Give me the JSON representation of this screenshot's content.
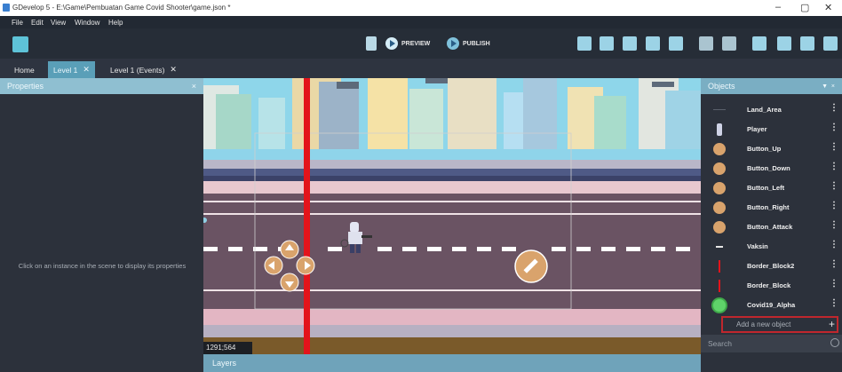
{
  "window": {
    "title": "GDevelop 5 - E:\\Game\\Pembuatan Game Covid Shooter\\game.json *",
    "controls": [
      "–",
      "▢",
      "✕"
    ]
  },
  "menu": [
    "File",
    "Edit",
    "View",
    "Window",
    "Help"
  ],
  "toolbar": {
    "preview_label": "PREVIEW",
    "publish_label": "PUBLISH"
  },
  "tabs": [
    {
      "label": "Home",
      "closable": false,
      "active": false
    },
    {
      "label": "Level 1",
      "closable": true,
      "active": true
    },
    {
      "label": "Level 1 (Events)",
      "closable": true,
      "active": false
    }
  ],
  "properties": {
    "title": "Properties",
    "close": "×",
    "hint": "Click on an instance in the scene to display its properties"
  },
  "scene": {
    "coordinates": "1291;564"
  },
  "layers": {
    "title": "Layers"
  },
  "objects": {
    "title": "Objects",
    "items": [
      {
        "label": "Land_Area",
        "icon": "land-icon"
      },
      {
        "label": "Player",
        "icon": "player-icon"
      },
      {
        "label": "Button_Up",
        "icon": "arrow-up-button-icon"
      },
      {
        "label": "Button_Down",
        "icon": "arrow-down-button-icon"
      },
      {
        "label": "Button_Left",
        "icon": "arrow-left-button-icon"
      },
      {
        "label": "Button_Right",
        "icon": "arrow-right-button-icon"
      },
      {
        "label": "Button_Attack",
        "icon": "syringe-button-icon"
      },
      {
        "label": "Vaksin",
        "icon": "vaccine-icon"
      },
      {
        "label": "Border_Block2",
        "icon": "red-border-icon"
      },
      {
        "label": "Border_Block",
        "icon": "red-border-icon"
      },
      {
        "label": "Covid19_Alpha",
        "icon": "virus-icon"
      }
    ],
    "more": "⋮",
    "add_new": "Add a new object",
    "add_plus": "+",
    "search_placeholder": "Search"
  },
  "colors": {
    "accent_tab": "#5a9fb8",
    "panel_header": "#8fbfd1",
    "highlight_border": "#c0272d",
    "scene_red_line": "#e3141b"
  }
}
